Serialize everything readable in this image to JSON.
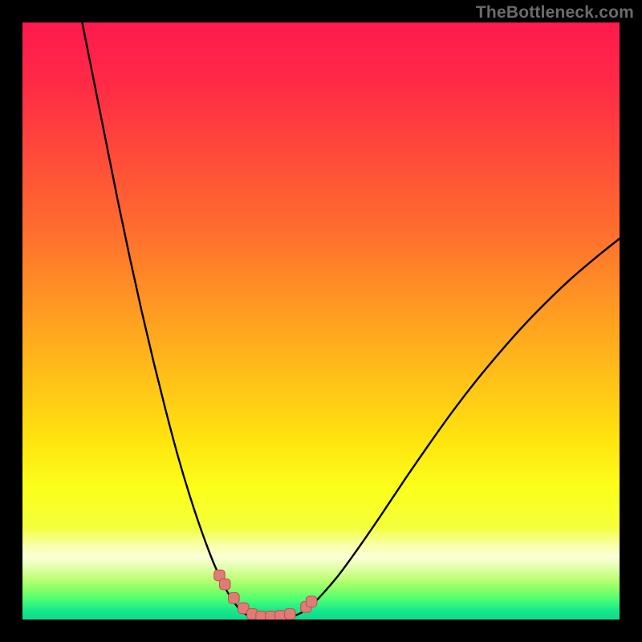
{
  "watermark": "TheBottleneck.com",
  "colors": {
    "bg": "#000000",
    "curve": "#000000",
    "marker_fill": "#e27a76",
    "marker_stroke": "#b9514e",
    "gradient_stops": [
      {
        "offset": 0.0,
        "color": "#ff1a4d"
      },
      {
        "offset": 0.1,
        "color": "#ff2a46"
      },
      {
        "offset": 0.22,
        "color": "#ff4a3a"
      },
      {
        "offset": 0.35,
        "color": "#ff6e2e"
      },
      {
        "offset": 0.48,
        "color": "#ff9a22"
      },
      {
        "offset": 0.6,
        "color": "#ffc218"
      },
      {
        "offset": 0.7,
        "color": "#ffe40e"
      },
      {
        "offset": 0.78,
        "color": "#fcff1a"
      },
      {
        "offset": 0.845,
        "color": "#f4ff3a"
      },
      {
        "offset": 0.875,
        "color": "#f8ffa8"
      },
      {
        "offset": 0.895,
        "color": "#fbffd6"
      },
      {
        "offset": 0.912,
        "color": "#e2ffb0"
      },
      {
        "offset": 0.93,
        "color": "#c2ff7a"
      },
      {
        "offset": 0.948,
        "color": "#8cff66"
      },
      {
        "offset": 0.966,
        "color": "#4dff73"
      },
      {
        "offset": 0.985,
        "color": "#16e88a"
      },
      {
        "offset": 1.0,
        "color": "#0fd98f"
      }
    ]
  },
  "chart_data": {
    "type": "line",
    "title": "",
    "xlabel": "",
    "ylabel": "",
    "xlim": [
      0,
      100
    ],
    "ylim": [
      0,
      100
    ],
    "series": [
      {
        "name": "left_branch",
        "x": [
          10,
          12,
          14,
          16,
          18,
          20,
          22,
          24,
          26,
          28,
          30,
          32,
          33.5,
          35,
          36.5,
          38
        ],
        "y": [
          100,
          90,
          80,
          70,
          60.5,
          51.5,
          43,
          35,
          27.5,
          20.8,
          14.8,
          9.5,
          6.2,
          3.5,
          1.6,
          0.6
        ]
      },
      {
        "name": "valley_floor",
        "x": [
          38,
          40,
          42,
          44,
          46
        ],
        "y": [
          0.6,
          0.3,
          0.3,
          0.4,
          0.8
        ]
      },
      {
        "name": "right_branch",
        "x": [
          46,
          48,
          50,
          53,
          56,
          60,
          64,
          68,
          72,
          76,
          80,
          84,
          88,
          92,
          96,
          100
        ],
        "y": [
          0.8,
          2.0,
          4.0,
          7.5,
          11.6,
          17.4,
          23.4,
          29.2,
          34.8,
          40.0,
          44.8,
          49.3,
          53.4,
          57.2,
          60.6,
          63.8
        ]
      }
    ],
    "markers": {
      "name": "highlight_points",
      "x": [
        33.0,
        33.9,
        35.4,
        37.0,
        38.5,
        40.0,
        41.6,
        43.2,
        44.8,
        47.5,
        48.4
      ],
      "y": [
        7.4,
        5.9,
        3.6,
        1.9,
        0.9,
        0.5,
        0.5,
        0.6,
        0.9,
        2.1,
        3.0
      ]
    }
  }
}
